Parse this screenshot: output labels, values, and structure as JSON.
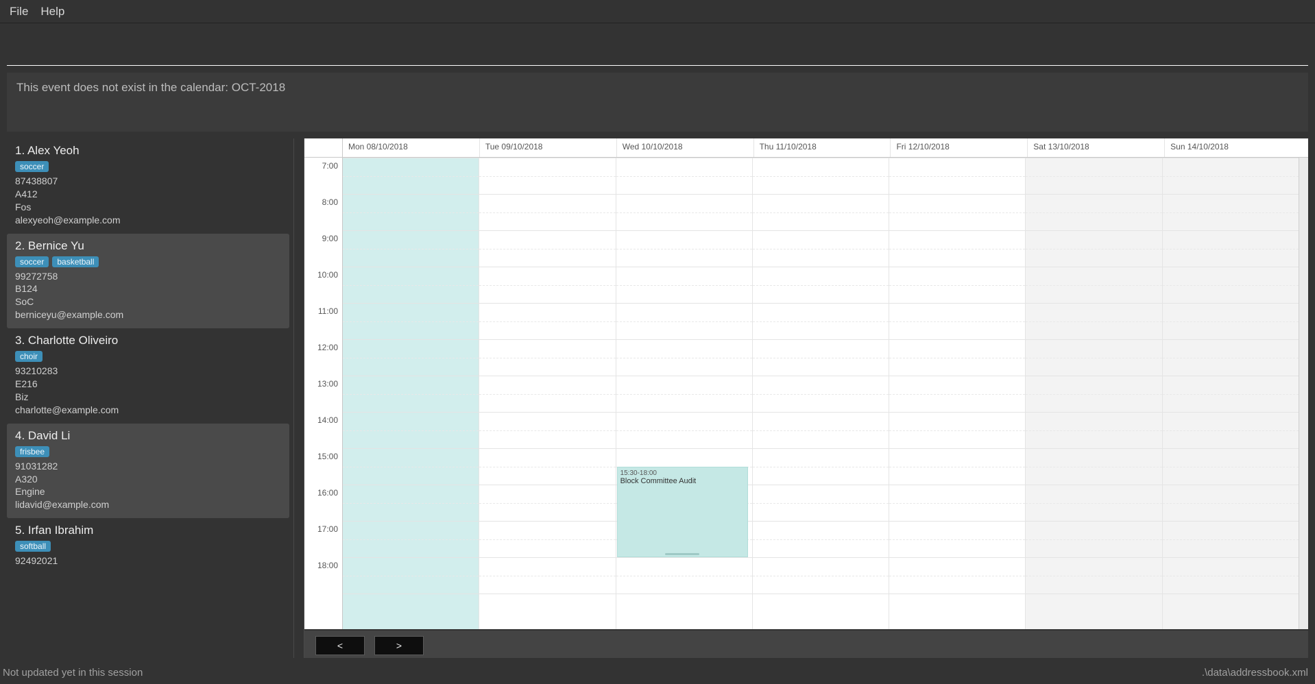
{
  "menu": {
    "file": "File",
    "help": "Help"
  },
  "message": "This event does not exist in the calendar: OCT-2018",
  "contacts": [
    {
      "idx": "1.",
      "name": "Alex Yeoh",
      "tags": [
        "soccer"
      ],
      "phone": "87438807",
      "room": "A412",
      "dept": "Fos",
      "email": "alexyeoh@example.com",
      "selected": false
    },
    {
      "idx": "2.",
      "name": "Bernice Yu",
      "tags": [
        "soccer",
        "basketball"
      ],
      "phone": "99272758",
      "room": "B124",
      "dept": "SoC",
      "email": "berniceyu@example.com",
      "selected": true
    },
    {
      "idx": "3.",
      "name": "Charlotte Oliveiro",
      "tags": [
        "choir"
      ],
      "phone": "93210283",
      "room": "E216",
      "dept": "Biz",
      "email": "charlotte@example.com",
      "selected": false
    },
    {
      "idx": "4.",
      "name": "David Li",
      "tags": [
        "frisbee"
      ],
      "phone": "91031282",
      "room": "A320",
      "dept": "Engine",
      "email": "lidavid@example.com",
      "selected": true
    },
    {
      "idx": "5.",
      "name": "Irfan Ibrahim",
      "tags": [
        "softball"
      ],
      "phone": "92492021",
      "room": "",
      "dept": "",
      "email": "",
      "selected": false
    }
  ],
  "calendar": {
    "days": [
      {
        "label": "Mon 08/10/2018",
        "today": true,
        "weekend": false
      },
      {
        "label": "Tue 09/10/2018",
        "today": false,
        "weekend": false
      },
      {
        "label": "Wed 10/10/2018",
        "today": false,
        "weekend": false
      },
      {
        "label": "Thu 11/10/2018",
        "today": false,
        "weekend": false
      },
      {
        "label": "Fri 12/10/2018",
        "today": false,
        "weekend": false
      },
      {
        "label": "Sat 13/10/2018",
        "today": false,
        "weekend": true
      },
      {
        "label": "Sun 14/10/2018",
        "today": false,
        "weekend": true
      }
    ],
    "startHour": 7,
    "endHour": 19,
    "hourHeight": 53,
    "events": [
      {
        "dayIndex": 2,
        "start": 15.5,
        "end": 18.0,
        "timeLabel": "15:30-18:00",
        "title": "Block Committee Audit"
      }
    ],
    "nav": {
      "prev": "<",
      "next": ">"
    }
  },
  "status": {
    "left": "Not updated yet in this session",
    "right": ".\\data\\addressbook.xml"
  }
}
